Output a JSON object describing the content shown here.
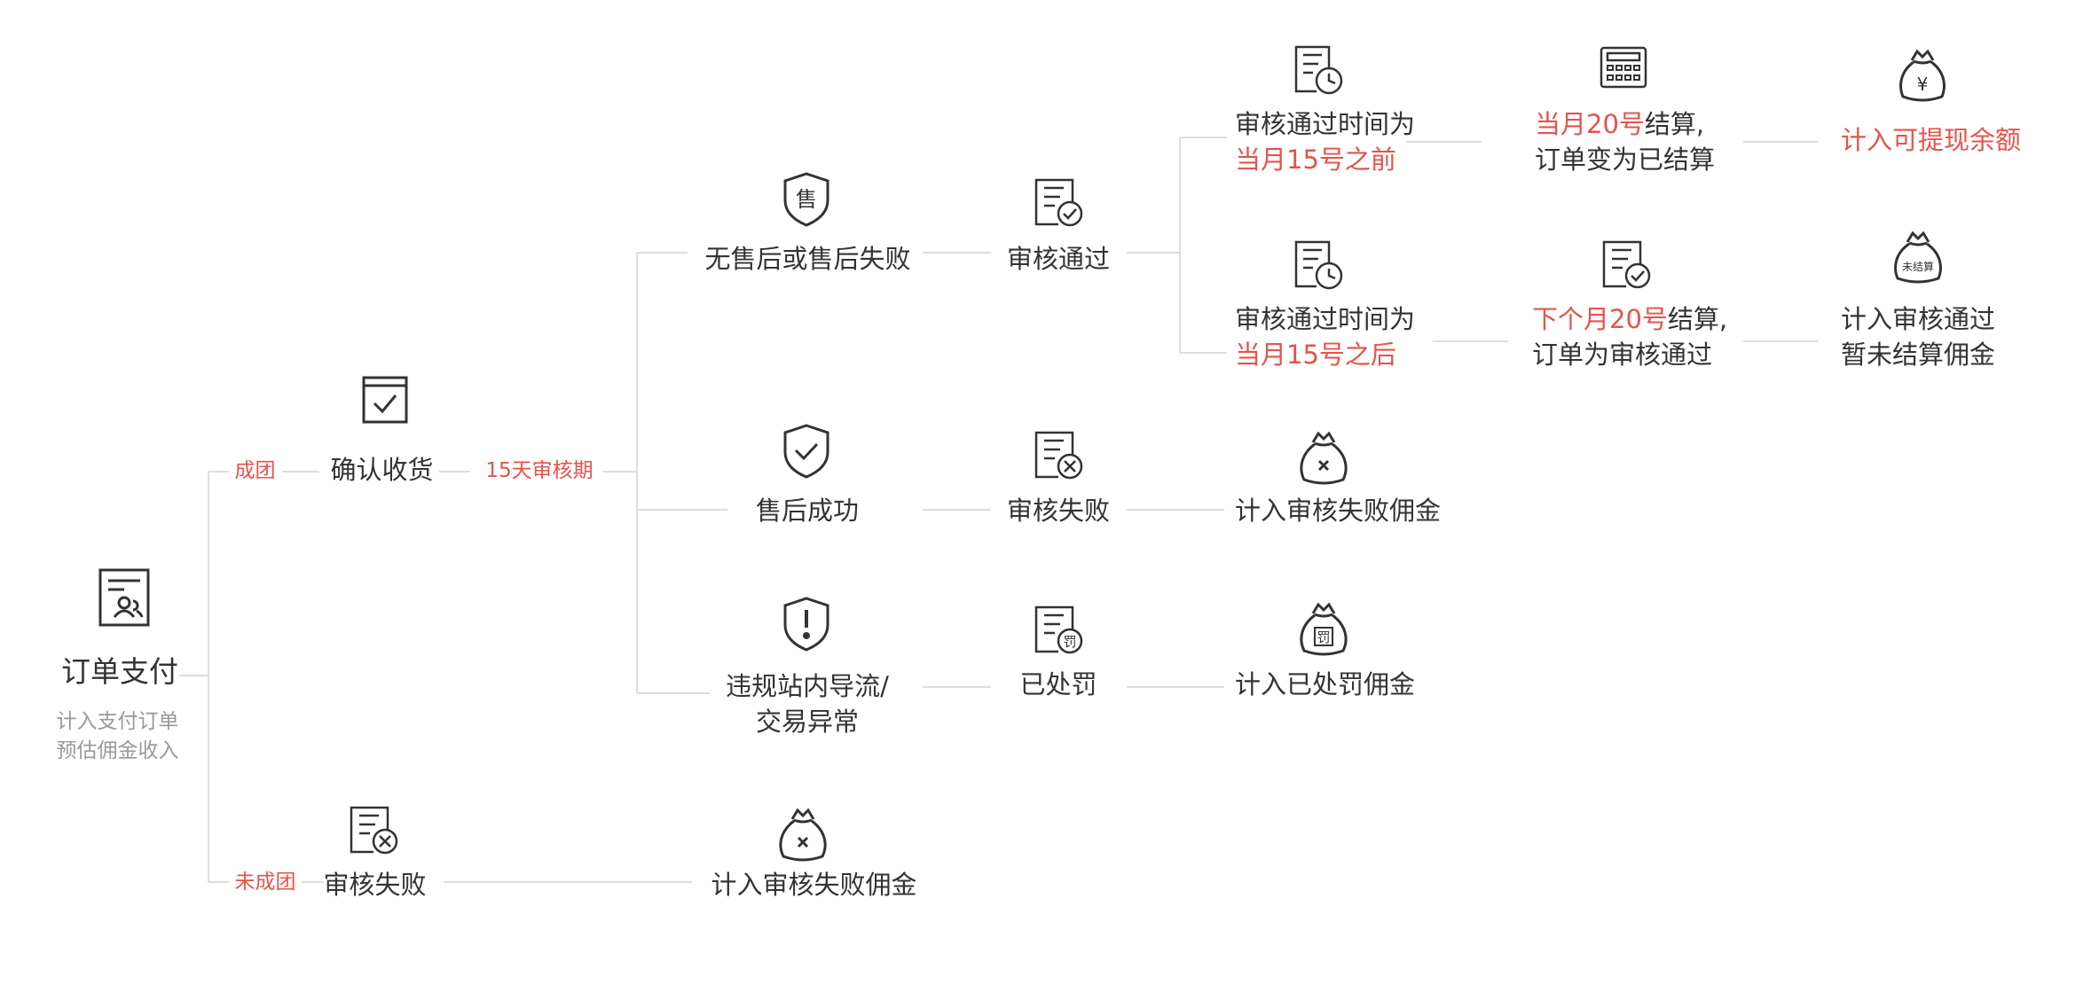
{
  "colors": {
    "accent": "#e5534b",
    "text": "#333333",
    "muted": "#999999",
    "line": "#dddddd"
  },
  "root": {
    "label": "订单支付",
    "sub1": "计入支付订单",
    "sub2": "预估佣金收入",
    "icon": "payment-order-icon"
  },
  "edges": {
    "success": "成团",
    "fail": "未成团",
    "period": "15天审核期"
  },
  "confirm": {
    "label": "确认收货",
    "icon": "box-check-icon"
  },
  "groupFail": {
    "label": "审核失败",
    "icon": "doc-x-icon",
    "result": "计入审核失败佣金",
    "result_icon": "money-bag-x-icon"
  },
  "branch1": {
    "label": "无售后或售后失败",
    "icon": "shield-sale-icon",
    "audit": "审核通过",
    "audit_icon": "doc-check-icon",
    "before": {
      "line1": "审核通过时间为",
      "line2": "当月15号之前",
      "icon": "doc-clock-icon",
      "settle_red": "当月20号",
      "settle_rest": "结算,",
      "settle_line2": "订单变为已结算",
      "settle_icon": "calculator-icon",
      "final": "计入可提现余额",
      "final_icon": "money-bag-yen-icon"
    },
    "after": {
      "line1": "审核通过时间为",
      "line2": "当月15号之后",
      "icon": "doc-clock-icon",
      "settle_red": "下个月20号",
      "settle_rest": "结算,",
      "settle_line2": "订单为审核通过",
      "settle_icon": "doc-check-icon",
      "final_line1": "计入审核通过",
      "final_line2": "暂未结算佣金",
      "final_icon": "money-bag-unsettled-icon",
      "bag_text": "未结算"
    }
  },
  "branch2": {
    "label": "售后成功",
    "icon": "shield-check-icon",
    "audit": "审核失败",
    "audit_icon": "doc-x-icon",
    "result": "计入审核失败佣金",
    "result_icon": "money-bag-x-icon"
  },
  "branch3": {
    "line1": "违规站内导流/",
    "line2": "交易异常",
    "icon": "shield-alert-icon",
    "audit": "已处罚",
    "audit_icon": "doc-penalty-icon",
    "stamp": "罚",
    "result": "计入已处罚佣金",
    "result_icon": "money-bag-penalty-icon",
    "bag_text": "罚"
  }
}
